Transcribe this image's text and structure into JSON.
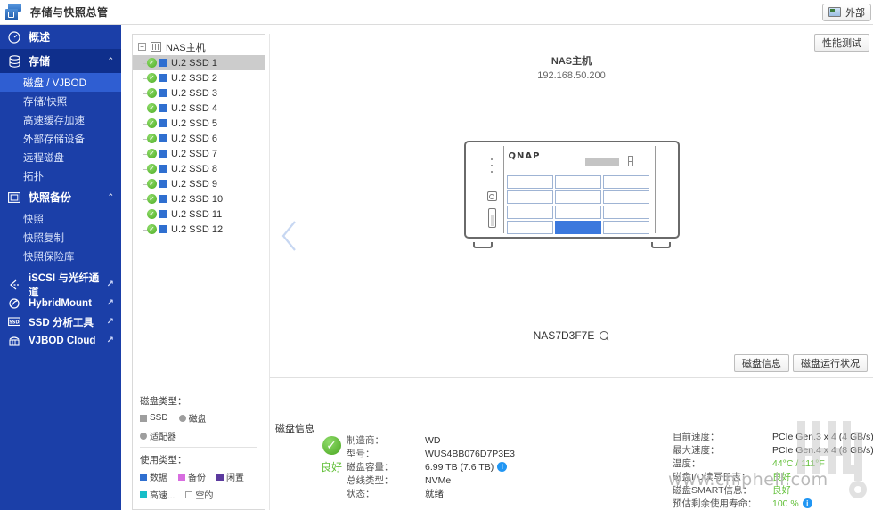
{
  "titlebar": {
    "app_name": "存储与快照总管",
    "app_icon": "storage-snapshot-icon",
    "external_button_label": "外部"
  },
  "toolbar": {
    "performance_test_label": "性能测试"
  },
  "sidebar": {
    "items": [
      {
        "label": "概述",
        "icon": "dashboard-icon",
        "type": "group",
        "expandable": false,
        "selected": false
      },
      {
        "label": "存储",
        "icon": "storage-icon",
        "type": "group",
        "expandable": true,
        "expanded": true,
        "selected": true
      },
      {
        "label": "磁盘 / VJBOD",
        "type": "sub",
        "selected": true
      },
      {
        "label": "存储/快照",
        "type": "sub",
        "selected": false
      },
      {
        "label": "高速缓存加速",
        "type": "sub",
        "selected": false
      },
      {
        "label": "外部存储设备",
        "type": "sub",
        "selected": false
      },
      {
        "label": "远程磁盘",
        "type": "sub",
        "selected": false
      },
      {
        "label": "拓扑",
        "type": "sub",
        "selected": false
      },
      {
        "label": "快照备份",
        "icon": "snapshot-icon",
        "type": "group",
        "expandable": true,
        "expanded": true,
        "selected": false
      },
      {
        "label": "快照",
        "type": "sub",
        "selected": false
      },
      {
        "label": "快照复制",
        "type": "sub",
        "selected": false
      },
      {
        "label": "快照保险库",
        "type": "sub",
        "selected": false
      }
    ],
    "links": [
      {
        "label": "iSCSI 与光纤通道",
        "icon": "iscsi-icon",
        "external": true
      },
      {
        "label": "HybridMount",
        "icon": "hybridmount-icon",
        "external": true
      },
      {
        "label": "SSD 分析工具",
        "icon": "ssd-profiling-icon",
        "external": true
      },
      {
        "label": "VJBOD Cloud",
        "icon": "vjbod-cloud-icon",
        "external": true
      }
    ],
    "chevron_glyph": "⌃",
    "external_glyph": "↗"
  },
  "tree": {
    "root_label": "NAS主机",
    "root_icon": "enclosure-icon",
    "expander_glyph": "−",
    "status_glyph": "✓",
    "disks": [
      {
        "label": "U.2 SSD 1",
        "status": "good",
        "selected": true
      },
      {
        "label": "U.2 SSD 2",
        "status": "good",
        "selected": false
      },
      {
        "label": "U.2 SSD 3",
        "status": "good",
        "selected": false
      },
      {
        "label": "U.2 SSD 4",
        "status": "good",
        "selected": false
      },
      {
        "label": "U.2 SSD 5",
        "status": "good",
        "selected": false
      },
      {
        "label": "U.2 SSD 6",
        "status": "good",
        "selected": false
      },
      {
        "label": "U.2 SSD 7",
        "status": "good",
        "selected": false
      },
      {
        "label": "U.2 SSD 8",
        "status": "good",
        "selected": false
      },
      {
        "label": "U.2 SSD 9",
        "status": "good",
        "selected": false
      },
      {
        "label": "U.2 SSD 10",
        "status": "good",
        "selected": false
      },
      {
        "label": "U.2 SSD 11",
        "status": "good",
        "selected": false
      },
      {
        "label": "U.2 SSD 12",
        "status": "good",
        "selected": false
      }
    ]
  },
  "legend": {
    "disk_type_title": "磁盘类型：",
    "disk_types": [
      {
        "label": "SSD",
        "shape": "square",
        "color": "#9e9e9e"
      },
      {
        "label": "磁盘",
        "shape": "circle",
        "color": "#9e9e9e"
      },
      {
        "label": "适配器",
        "shape": "circle",
        "color": "#9e9e9e"
      }
    ],
    "usage_type_title": "使用类型：",
    "usage_types": [
      {
        "label": "数据",
        "color": "#2f6fd0"
      },
      {
        "label": "备份",
        "color": "#d86de0"
      },
      {
        "label": "闲置",
        "color": "#5b3a9e"
      },
      {
        "label": "高速...",
        "color": "#17bec8"
      },
      {
        "label": "空的",
        "color": "#ffffff"
      }
    ]
  },
  "main": {
    "nas_name": "NAS主机",
    "nas_ip": "192.168.50.200",
    "prev_arrow_icon": "chevron-left-icon",
    "chassis_brand": "QNAP",
    "bays_total": 12,
    "bays_used": [
      10
    ],
    "serial": "NAS7D3F7E",
    "serial_zoom_icon": "magnifier-icon",
    "tabs": [
      {
        "label": "磁盘信息",
        "active": true
      },
      {
        "label": "磁盘运行状况",
        "active": false
      }
    ]
  },
  "disk_info": {
    "section_title": "磁盘信息",
    "health_status": "良好",
    "health_icon": "check-circle-icon",
    "left_fields": [
      {
        "key": "制造商：",
        "value": "WD"
      },
      {
        "key": "型号：",
        "value": "WUS4BB076D7P3E3"
      },
      {
        "key": "磁盘容量：",
        "value": "6.99 TB (7.6 TB)",
        "info_icon": true
      },
      {
        "key": "总线类型：",
        "value": "NVMe"
      },
      {
        "key": "状态：",
        "value": "就绪"
      }
    ],
    "right_fields": [
      {
        "key": "目前速度：",
        "value": "PCIe Gen.3 x 4 (4 GB/s)",
        "green": false
      },
      {
        "key": "最大速度：",
        "value": "PCIe Gen.4 x 4 (8 GB/s)",
        "green": false
      },
      {
        "key": "温度：",
        "value": "44°C / 111°F",
        "green": true
      },
      {
        "key": "磁盘I/O读写日志：",
        "value": "良好",
        "green": true
      },
      {
        "key": "磁盘SMART信息：",
        "value": "良好",
        "green": true
      },
      {
        "key": "预估剩余使用寿命：",
        "value": "100 %",
        "green": true,
        "info_icon": true
      }
    ]
  },
  "watermark": {
    "text": "www.chiphell.com"
  },
  "colors": {
    "sidebar_bg": "#1b3fa8",
    "sidebar_selected": "#2f5ed2",
    "accent_blue": "#2f6fd0",
    "health_green": "#63c03a",
    "info_blue": "#2196f3"
  }
}
